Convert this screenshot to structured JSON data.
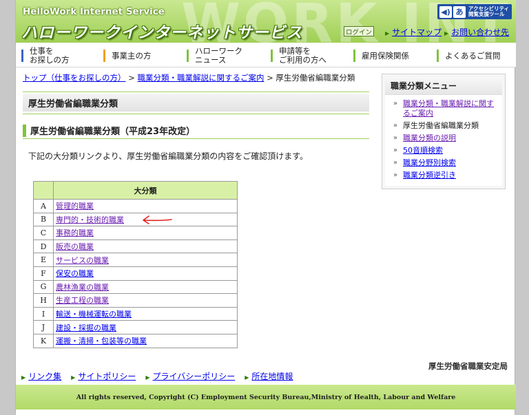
{
  "header": {
    "brand_en": "HelloWork Internet Service",
    "brand_jp": "ハローワークインターネットサービス",
    "bg_watermark": "WORK INTER",
    "access_icon_1": "◀)",
    "access_icon_2": "あ",
    "access_line1": "アクセシビリティ",
    "access_line2": "閲覧支援ツール",
    "login": "ログイン",
    "sitemap": "サイトマップ",
    "contact": "お問い合わせ先"
  },
  "nav": {
    "items": [
      {
        "line1": "仕事を",
        "line2": "お探しの方",
        "color": "#3c64c8"
      },
      {
        "line1": "事業主の方",
        "line2": "",
        "color": "#f0a020"
      },
      {
        "line1": "ハローワーク",
        "line2": "ニュース",
        "color": "#7fc33b"
      },
      {
        "line1": "申請等を",
        "line2": "ご利用の方へ",
        "color": "#7fc33b"
      },
      {
        "line1": "雇用保険関係",
        "line2": "",
        "color": "#7fc33b"
      },
      {
        "line1": "よくあるご質問",
        "line2": "",
        "color": "#7fc33b"
      }
    ]
  },
  "breadcrumb": {
    "top": "トップ（仕事をお探しの方）",
    "sep1": " > ",
    "guide": "職業分類・職業解説に関するご案内",
    "sep2": " > ",
    "current": "厚生労働省編職業分類"
  },
  "main": {
    "page_title": "厚生労働省編職業分類",
    "section_title": "厚生労働省編職業分類（平成23年改定）",
    "intro": "下記の大分類リンクより、厚生労働省編職業分類の内容をご確認頂けます。",
    "table_header": "大分類",
    "rows": [
      {
        "code": "A",
        "name": "管理的職業"
      },
      {
        "code": "B",
        "name": "専門的・技術的職業"
      },
      {
        "code": "C",
        "name": "事務的職業"
      },
      {
        "code": "D",
        "name": "販売の職業"
      },
      {
        "code": "E",
        "name": "サービスの職業"
      },
      {
        "code": "F",
        "name": "保安の職業"
      },
      {
        "code": "G",
        "name": "農林漁業の職業"
      },
      {
        "code": "H",
        "name": "生産工程の職業"
      },
      {
        "code": "I",
        "name": "輸送・機械運転の職業"
      },
      {
        "code": "J",
        "name": "建設・採掘の職業"
      },
      {
        "code": "K",
        "name": "運搬・清掃・包装等の職業"
      }
    ]
  },
  "sidebar": {
    "title": "職業分類メニュー",
    "bullet": "»",
    "items": [
      {
        "label": "職業分類・職業解説に関するご案内"
      },
      {
        "label": "厚生労働省編職業分類"
      },
      {
        "label": "職業分類の説明"
      },
      {
        "label": "50音順検索"
      },
      {
        "label": "職業分野別検索"
      },
      {
        "label": "職業分類逆引き"
      }
    ]
  },
  "footer": {
    "bureau": "厚生労働省職業安定局",
    "links": [
      {
        "label": "リンク集"
      },
      {
        "label": "サイトポリシー"
      },
      {
        "label": "プライバシーポリシー"
      },
      {
        "label": "所在地情報"
      }
    ],
    "copyright": "All rights reserved, Copyright (C) Employment Security Bureau,Ministry of Health, Labour and Welfare"
  },
  "colors": {
    "header_green": "#9fcf55",
    "link": "#0000ee",
    "visited": "#6b1fb2",
    "table_header_bg": "#d8f0a6",
    "annotation_arrow": "#e02020"
  }
}
